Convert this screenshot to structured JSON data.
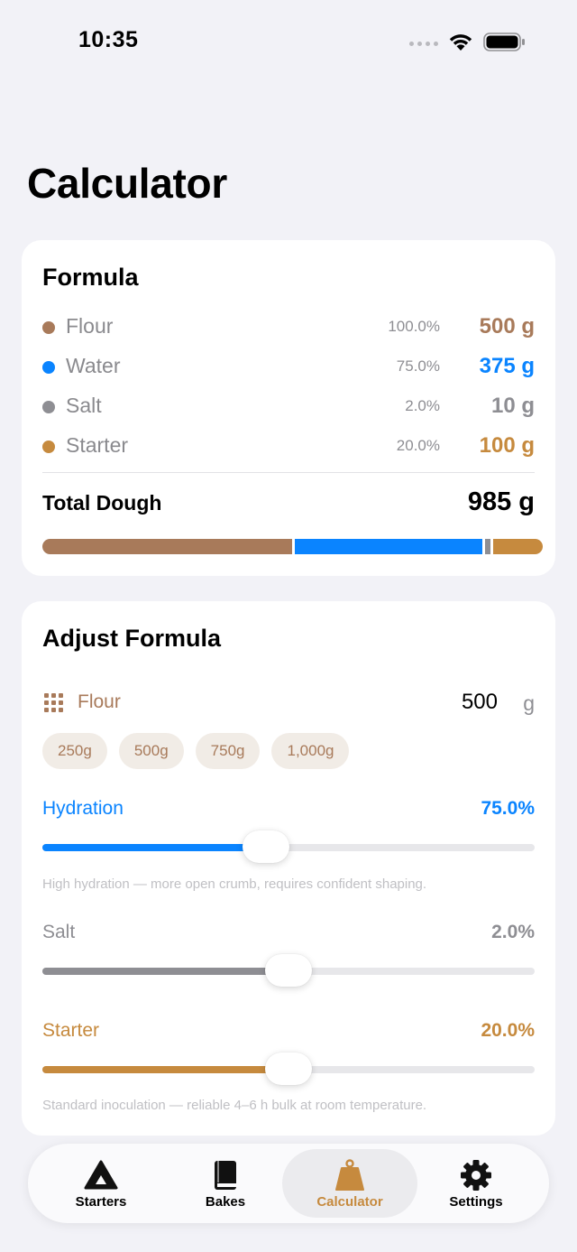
{
  "status_bar": {
    "time": "10:35"
  },
  "page_title": "Calculator",
  "colors": {
    "flour": "#a87a5a",
    "water": "#0a84ff",
    "salt": "#8e8e93",
    "starter": "#c68a3e"
  },
  "formula": {
    "title": "Formula",
    "ingredients": [
      {
        "name": "Flour",
        "percent": "100.0%",
        "weight": "500 g",
        "color": "#a87a5a",
        "grams": 500
      },
      {
        "name": "Water",
        "percent": "75.0%",
        "weight": "375 g",
        "color": "#0a84ff",
        "grams": 375
      },
      {
        "name": "Salt",
        "percent": "2.0%",
        "weight": "10 g",
        "color": "#8e8e93",
        "grams": 10
      },
      {
        "name": "Starter",
        "percent": "20.0%",
        "weight": "100 g",
        "color": "#c68a3e",
        "grams": 100
      }
    ],
    "total_label": "Total Dough",
    "total_value": "985 g"
  },
  "adjust": {
    "title": "Adjust Formula",
    "flour": {
      "icon": "grid-icon",
      "label": "Flour",
      "value": "500",
      "unit": "g",
      "presets": [
        "250g",
        "500g",
        "750g",
        "1,000g"
      ]
    },
    "hydration": {
      "label": "Hydration",
      "value": "75.0%",
      "level": 0.455,
      "color": "#0a84ff",
      "hint": "High hydration — more open crumb, requires confident shaping."
    },
    "salt": {
      "label": "Salt",
      "value": "2.0%",
      "level": 0.5,
      "color": "#8e8e93"
    },
    "starter": {
      "label": "Starter",
      "value": "20.0%",
      "level": 0.5,
      "color": "#c68a3e",
      "hint": "Standard inoculation — reliable 4–6 h bulk at room temperature."
    }
  },
  "tabs": [
    {
      "label": "Starters",
      "icon": "triangle-icon",
      "active": false
    },
    {
      "label": "Bakes",
      "icon": "book-icon",
      "active": false
    },
    {
      "label": "Calculator",
      "icon": "scale-weight-icon",
      "active": true
    },
    {
      "label": "Settings",
      "icon": "gear-icon",
      "active": false
    }
  ]
}
